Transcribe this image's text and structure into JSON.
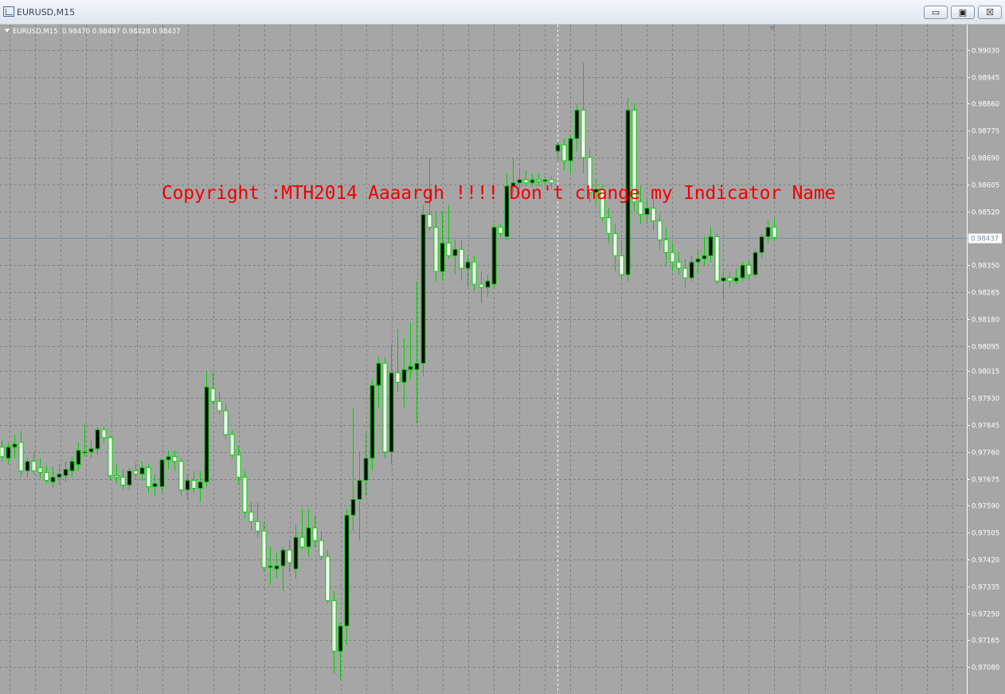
{
  "window": {
    "title": "EURUSD,M15",
    "buttons": {
      "minimize": "▭",
      "maximize": "▣",
      "close": "☒"
    }
  },
  "chart_header": {
    "symbol_timeframe": "EURUSD,M15",
    "ohlc": "0.98470 0.98497 0.98428 0.98437"
  },
  "overlay_text": "Copyright :MTH2014 Aaaargh !!!! Don't change my Indicator Name",
  "colors": {
    "background": "#a6a6a6",
    "grid": "#808080",
    "wick": "#00d000",
    "bull_body": "#000000",
    "bear_body": "#ffffff",
    "bid_line": "#7890a8",
    "axis_text": "#ffffff",
    "price_tag_bg": "#ffffff",
    "price_tag_text": "#7890a8",
    "overlay_text": "#f00000"
  },
  "chart_data": {
    "type": "candlestick",
    "symbol": "EURUSD",
    "timeframe": "M15",
    "current_price": "0.98437",
    "y_ticks": [
      "0.99030",
      "0.98945",
      "0.98860",
      "0.98775",
      "0.98690",
      "0.98605",
      "0.98520",
      "0.98350",
      "0.98265",
      "0.98180",
      "0.98095",
      "0.98015",
      "0.97930",
      "0.97845",
      "0.97760",
      "0.97675",
      "0.97590",
      "0.97505",
      "0.97420",
      "0.97335",
      "0.97250",
      "0.97165",
      "0.97080"
    ],
    "ylim": [
      0.96995,
      0.9911
    ],
    "crosshair_candle_index": 87,
    "candles": [
      {
        "o": 0.97775,
        "h": 0.978,
        "l": 0.9773,
        "c": 0.97745
      },
      {
        "o": 0.9774,
        "h": 0.9779,
        "l": 0.9772,
        "c": 0.97775
      },
      {
        "o": 0.97775,
        "h": 0.97815,
        "l": 0.9774,
        "c": 0.97785
      },
      {
        "o": 0.9779,
        "h": 0.97825,
        "l": 0.9768,
        "c": 0.977
      },
      {
        "o": 0.977,
        "h": 0.9774,
        "l": 0.9768,
        "c": 0.9773
      },
      {
        "o": 0.9773,
        "h": 0.9776,
        "l": 0.9769,
        "c": 0.977
      },
      {
        "o": 0.9771,
        "h": 0.9774,
        "l": 0.9768,
        "c": 0.97695
      },
      {
        "o": 0.97695,
        "h": 0.97715,
        "l": 0.9766,
        "c": 0.9767
      },
      {
        "o": 0.97665,
        "h": 0.97715,
        "l": 0.97645,
        "c": 0.9768
      },
      {
        "o": 0.9768,
        "h": 0.9772,
        "l": 0.97655,
        "c": 0.9769
      },
      {
        "o": 0.97685,
        "h": 0.9773,
        "l": 0.97665,
        "c": 0.97705
      },
      {
        "o": 0.977,
        "h": 0.97745,
        "l": 0.9768,
        "c": 0.9773
      },
      {
        "o": 0.9772,
        "h": 0.9779,
        "l": 0.977,
        "c": 0.97765
      },
      {
        "o": 0.9776,
        "h": 0.9785,
        "l": 0.97745,
        "c": 0.9776
      },
      {
        "o": 0.9776,
        "h": 0.97795,
        "l": 0.9774,
        "c": 0.9777
      },
      {
        "o": 0.9777,
        "h": 0.9784,
        "l": 0.9775,
        "c": 0.9783
      },
      {
        "o": 0.9783,
        "h": 0.9784,
        "l": 0.9779,
        "c": 0.97805
      },
      {
        "o": 0.97805,
        "h": 0.9781,
        "l": 0.9767,
        "c": 0.97685
      },
      {
        "o": 0.97685,
        "h": 0.9772,
        "l": 0.9766,
        "c": 0.9768
      },
      {
        "o": 0.9768,
        "h": 0.97705,
        "l": 0.9764,
        "c": 0.97655
      },
      {
        "o": 0.97655,
        "h": 0.9771,
        "l": 0.9764,
        "c": 0.977
      },
      {
        "o": 0.977,
        "h": 0.97725,
        "l": 0.97675,
        "c": 0.9769
      },
      {
        "o": 0.9769,
        "h": 0.9773,
        "l": 0.9767,
        "c": 0.9771
      },
      {
        "o": 0.9771,
        "h": 0.9772,
        "l": 0.9763,
        "c": 0.9765
      },
      {
        "o": 0.9765,
        "h": 0.9769,
        "l": 0.9762,
        "c": 0.9766
      },
      {
        "o": 0.9765,
        "h": 0.9774,
        "l": 0.9763,
        "c": 0.97735
      },
      {
        "o": 0.97735,
        "h": 0.97765,
        "l": 0.97705,
        "c": 0.97745
      },
      {
        "o": 0.97745,
        "h": 0.97765,
        "l": 0.977,
        "c": 0.9773
      },
      {
        "o": 0.9773,
        "h": 0.9774,
        "l": 0.9762,
        "c": 0.9764
      },
      {
        "o": 0.9764,
        "h": 0.9769,
        "l": 0.9761,
        "c": 0.9767
      },
      {
        "o": 0.9767,
        "h": 0.977,
        "l": 0.9763,
        "c": 0.97645
      },
      {
        "o": 0.97645,
        "h": 0.977,
        "l": 0.976,
        "c": 0.97665
      },
      {
        "o": 0.97665,
        "h": 0.98015,
        "l": 0.9765,
        "c": 0.97965
      },
      {
        "o": 0.9796,
        "h": 0.9801,
        "l": 0.9791,
        "c": 0.9792
      },
      {
        "o": 0.9792,
        "h": 0.9795,
        "l": 0.9788,
        "c": 0.9789
      },
      {
        "o": 0.9789,
        "h": 0.9791,
        "l": 0.978,
        "c": 0.97815
      },
      {
        "o": 0.97815,
        "h": 0.9783,
        "l": 0.9774,
        "c": 0.9775
      },
      {
        "o": 0.9775,
        "h": 0.9778,
        "l": 0.9766,
        "c": 0.9768
      },
      {
        "o": 0.9768,
        "h": 0.977,
        "l": 0.9755,
        "c": 0.9757
      },
      {
        "o": 0.9757,
        "h": 0.976,
        "l": 0.9751,
        "c": 0.9754
      },
      {
        "o": 0.9754,
        "h": 0.976,
        "l": 0.9749,
        "c": 0.9751
      },
      {
        "o": 0.9751,
        "h": 0.9754,
        "l": 0.9738,
        "c": 0.97395
      },
      {
        "o": 0.97395,
        "h": 0.9746,
        "l": 0.9734,
        "c": 0.974
      },
      {
        "o": 0.9739,
        "h": 0.9744,
        "l": 0.9736,
        "c": 0.974
      },
      {
        "o": 0.974,
        "h": 0.9746,
        "l": 0.9732,
        "c": 0.9745
      },
      {
        "o": 0.9745,
        "h": 0.9748,
        "l": 0.9738,
        "c": 0.9741
      },
      {
        "o": 0.9739,
        "h": 0.9753,
        "l": 0.9736,
        "c": 0.9749
      },
      {
        "o": 0.9749,
        "h": 0.9758,
        "l": 0.9745,
        "c": 0.9746
      },
      {
        "o": 0.9746,
        "h": 0.9758,
        "l": 0.9743,
        "c": 0.9752
      },
      {
        "o": 0.9752,
        "h": 0.9756,
        "l": 0.9746,
        "c": 0.9748
      },
      {
        "o": 0.9748,
        "h": 0.9751,
        "l": 0.9742,
        "c": 0.9743
      },
      {
        "o": 0.9743,
        "h": 0.9745,
        "l": 0.9728,
        "c": 0.9729
      },
      {
        "o": 0.9729,
        "h": 0.9732,
        "l": 0.9706,
        "c": 0.9713
      },
      {
        "o": 0.9713,
        "h": 0.9722,
        "l": 0.9704,
        "c": 0.9721
      },
      {
        "o": 0.9721,
        "h": 0.9758,
        "l": 0.9715,
        "c": 0.9756
      },
      {
        "o": 0.9756,
        "h": 0.979,
        "l": 0.9751,
        "c": 0.9761
      },
      {
        "o": 0.9761,
        "h": 0.9776,
        "l": 0.9748,
        "c": 0.9767
      },
      {
        "o": 0.9767,
        "h": 0.9782,
        "l": 0.9762,
        "c": 0.9774
      },
      {
        "o": 0.9774,
        "h": 0.9799,
        "l": 0.977,
        "c": 0.9797
      },
      {
        "o": 0.9797,
        "h": 0.9806,
        "l": 0.979,
        "c": 0.9804
      },
      {
        "o": 0.9804,
        "h": 0.9806,
        "l": 0.9774,
        "c": 0.9776
      },
      {
        "o": 0.9776,
        "h": 0.981,
        "l": 0.9772,
        "c": 0.9801
      },
      {
        "o": 0.9801,
        "h": 0.9815,
        "l": 0.9795,
        "c": 0.9798
      },
      {
        "o": 0.9798,
        "h": 0.9812,
        "l": 0.979,
        "c": 0.9802
      },
      {
        "o": 0.9802,
        "h": 0.9817,
        "l": 0.9799,
        "c": 0.9803
      },
      {
        "o": 0.9802,
        "h": 0.983,
        "l": 0.9785,
        "c": 0.9804
      },
      {
        "o": 0.9804,
        "h": 0.9854,
        "l": 0.98,
        "c": 0.9851
      },
      {
        "o": 0.9851,
        "h": 0.9869,
        "l": 0.9846,
        "c": 0.9847
      },
      {
        "o": 0.9847,
        "h": 0.9852,
        "l": 0.983,
        "c": 0.9833
      },
      {
        "o": 0.9833,
        "h": 0.9852,
        "l": 0.983,
        "c": 0.9842
      },
      {
        "o": 0.9842,
        "h": 0.9854,
        "l": 0.9837,
        "c": 0.9838
      },
      {
        "o": 0.9838,
        "h": 0.9843,
        "l": 0.9832,
        "c": 0.984
      },
      {
        "o": 0.984,
        "h": 0.9843,
        "l": 0.983,
        "c": 0.9834
      },
      {
        "o": 0.9834,
        "h": 0.9838,
        "l": 0.9828,
        "c": 0.9836
      },
      {
        "o": 0.9836,
        "h": 0.9838,
        "l": 0.9827,
        "c": 0.9829
      },
      {
        "o": 0.9829,
        "h": 0.9833,
        "l": 0.9823,
        "c": 0.9828
      },
      {
        "o": 0.9828,
        "h": 0.9832,
        "l": 0.9825,
        "c": 0.983
      },
      {
        "o": 0.9829,
        "h": 0.9848,
        "l": 0.9828,
        "c": 0.9847
      },
      {
        "o": 0.9847,
        "h": 0.9848,
        "l": 0.9844,
        "c": 0.9845
      },
      {
        "o": 0.9844,
        "h": 0.9864,
        "l": 0.9843,
        "c": 0.986
      },
      {
        "o": 0.986,
        "h": 0.9869,
        "l": 0.9858,
        "c": 0.9861
      },
      {
        "o": 0.9861,
        "h": 0.9865,
        "l": 0.9859,
        "c": 0.9862
      },
      {
        "o": 0.9862,
        "h": 0.9865,
        "l": 0.986,
        "c": 0.9861
      },
      {
        "o": 0.9861,
        "h": 0.9864,
        "l": 0.986,
        "c": 0.9862
      },
      {
        "o": 0.9862,
        "h": 0.9864,
        "l": 0.986,
        "c": 0.98615
      },
      {
        "o": 0.98615,
        "h": 0.9863,
        "l": 0.986,
        "c": 0.9862
      },
      {
        "o": 0.9862,
        "h": 0.9863,
        "l": 0.9859,
        "c": 0.9861
      },
      {
        "o": 0.9871,
        "h": 0.9874,
        "l": 0.9868,
        "c": 0.9873
      },
      {
        "o": 0.9873,
        "h": 0.9875,
        "l": 0.9865,
        "c": 0.9868
      },
      {
        "o": 0.9868,
        "h": 0.9876,
        "l": 0.9864,
        "c": 0.9875
      },
      {
        "o": 0.9875,
        "h": 0.9886,
        "l": 0.9871,
        "c": 0.9884
      },
      {
        "o": 0.9884,
        "h": 0.9899,
        "l": 0.9864,
        "c": 0.9869
      },
      {
        "o": 0.9869,
        "h": 0.9872,
        "l": 0.9855,
        "c": 0.9858
      },
      {
        "o": 0.9858,
        "h": 0.9862,
        "l": 0.9854,
        "c": 0.9859
      },
      {
        "o": 0.9859,
        "h": 0.986,
        "l": 0.9849,
        "c": 0.985
      },
      {
        "o": 0.985,
        "h": 0.9853,
        "l": 0.9842,
        "c": 0.9845
      },
      {
        "o": 0.9845,
        "h": 0.9848,
        "l": 0.9833,
        "c": 0.9838
      },
      {
        "o": 0.9838,
        "h": 0.9842,
        "l": 0.9831,
        "c": 0.9832
      },
      {
        "o": 0.9832,
        "h": 0.9888,
        "l": 0.983,
        "c": 0.9884
      },
      {
        "o": 0.9884,
        "h": 0.9886,
        "l": 0.9852,
        "c": 0.9855
      },
      {
        "o": 0.9855,
        "h": 0.986,
        "l": 0.9848,
        "c": 0.9851
      },
      {
        "o": 0.9851,
        "h": 0.9856,
        "l": 0.9848,
        "c": 0.9853
      },
      {
        "o": 0.9853,
        "h": 0.9856,
        "l": 0.9846,
        "c": 0.9849
      },
      {
        "o": 0.9849,
        "h": 0.9851,
        "l": 0.984,
        "c": 0.9843
      },
      {
        "o": 0.9843,
        "h": 0.9847,
        "l": 0.9835,
        "c": 0.9839
      },
      {
        "o": 0.9839,
        "h": 0.9842,
        "l": 0.9833,
        "c": 0.9836
      },
      {
        "o": 0.9836,
        "h": 0.9839,
        "l": 0.9832,
        "c": 0.9834
      },
      {
        "o": 0.9834,
        "h": 0.9837,
        "l": 0.9828,
        "c": 0.9831
      },
      {
        "o": 0.9831,
        "h": 0.9838,
        "l": 0.983,
        "c": 0.9836
      },
      {
        "o": 0.9836,
        "h": 0.984,
        "l": 0.9832,
        "c": 0.9837
      },
      {
        "o": 0.9837,
        "h": 0.9844,
        "l": 0.9835,
        "c": 0.9838
      },
      {
        "o": 0.9838,
        "h": 0.9847,
        "l": 0.9836,
        "c": 0.9844
      },
      {
        "o": 0.9844,
        "h": 0.9845,
        "l": 0.9829,
        "c": 0.983
      },
      {
        "o": 0.983,
        "h": 0.9833,
        "l": 0.9824,
        "c": 0.9831
      },
      {
        "o": 0.9831,
        "h": 0.9833,
        "l": 0.9828,
        "c": 0.983
      },
      {
        "o": 0.983,
        "h": 0.9834,
        "l": 0.9829,
        "c": 0.9831
      },
      {
        "o": 0.9831,
        "h": 0.9836,
        "l": 0.983,
        "c": 0.9835
      },
      {
        "o": 0.9835,
        "h": 0.9837,
        "l": 0.983,
        "c": 0.9832
      },
      {
        "o": 0.9832,
        "h": 0.984,
        "l": 0.9831,
        "c": 0.9839
      },
      {
        "o": 0.9839,
        "h": 0.9845,
        "l": 0.9837,
        "c": 0.9844
      },
      {
        "o": 0.9844,
        "h": 0.9849,
        "l": 0.9842,
        "c": 0.9847
      },
      {
        "o": 0.9847,
        "h": 0.98497,
        "l": 0.98428,
        "c": 0.98437
      }
    ]
  }
}
